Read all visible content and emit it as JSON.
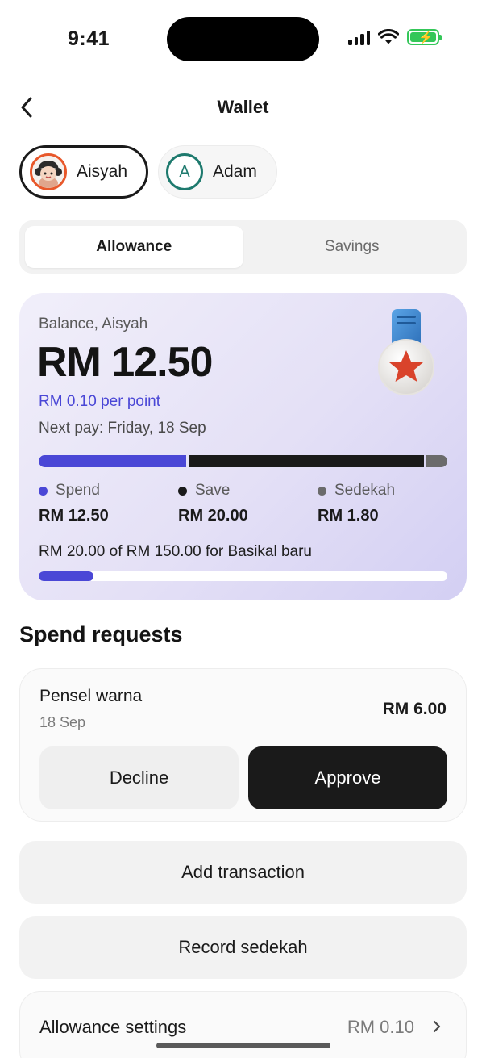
{
  "status_bar": {
    "time": "9:41",
    "battery_color": "#34c759"
  },
  "header": {
    "title": "Wallet",
    "back_icon": "chevron-left-icon"
  },
  "children": [
    {
      "name": "Aisyah",
      "selected": true,
      "avatar": "cartoon-girl-avatar",
      "ring_color": "#e8582b"
    },
    {
      "name": "Adam",
      "selected": false,
      "initial": "A",
      "ring_color": "#1e7a6e"
    }
  ],
  "tabs": {
    "allowance": "Allowance",
    "savings": "Savings",
    "active": "allowance"
  },
  "balance": {
    "label": "Balance, Aisyah",
    "amount": "RM 12.50",
    "rate": "RM 0.10 per point",
    "next_pay": "Next pay: Friday, 18 Sep",
    "medal_icon": "star-medal-icon",
    "split": [
      {
        "name": "Spend",
        "value": "RM 12.50",
        "amount": 12.5,
        "color": "#4a47d6"
      },
      {
        "name": "Save",
        "value": "RM 20.00",
        "amount": 20.0,
        "color": "#1a1a1a"
      },
      {
        "name": "Sedekah",
        "value": "RM 1.80",
        "amount": 1.8,
        "color": "#6b6b6b"
      }
    ],
    "goal_text": "RM 20.00 of RM 150.00 for Basikal baru",
    "goal_progress": 0.1333,
    "accent": "#4a47d6"
  },
  "spend_requests": {
    "title": "Spend requests",
    "items": [
      {
        "name": "Pensel warna",
        "date": "18 Sep",
        "amount": "RM 6.00",
        "decline_label": "Decline",
        "approve_label": "Approve"
      }
    ]
  },
  "actions": {
    "add_transaction": "Add transaction",
    "record_sedekah": "Record sedekah"
  },
  "settings": {
    "label": "Allowance settings",
    "value": "RM 0.10",
    "chevron_icon": "chevron-right-icon"
  }
}
